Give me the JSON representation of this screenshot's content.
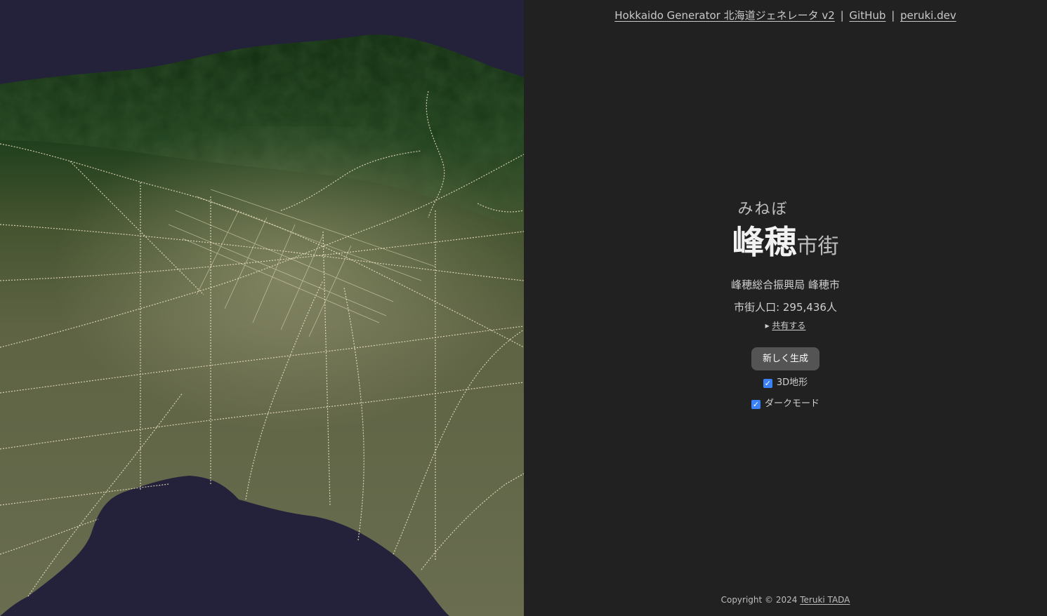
{
  "header": {
    "app_link": "Hokkaido Generator 北海道ジェネレータ v2",
    "separator": "|",
    "github_link": "GitHub",
    "site_link": "peruki.dev"
  },
  "town": {
    "ruby": "みねぼ",
    "name": "峰穂",
    "suffix": "市街",
    "subprefecture": "峰穂総合振興局 峰穂市",
    "population": "市街人口: 295,436人"
  },
  "share": {
    "arrow": "▸",
    "label": "共有する"
  },
  "controls": {
    "generate_label": "新しく生成",
    "terrain_label": "3D地形",
    "terrain_checked": true,
    "dark_label": "ダークモード",
    "dark_checked": true
  },
  "footer": {
    "copyright": "Copyright © 2024",
    "author": "Teruki TADA"
  },
  "colors": {
    "background": "#212121",
    "sea": "#24223a",
    "mountain": "#1d3a1a",
    "plain": "#6b6e4e",
    "road": "#f1e6c8",
    "checkbox": "#3b82f6",
    "button": "#545454"
  }
}
